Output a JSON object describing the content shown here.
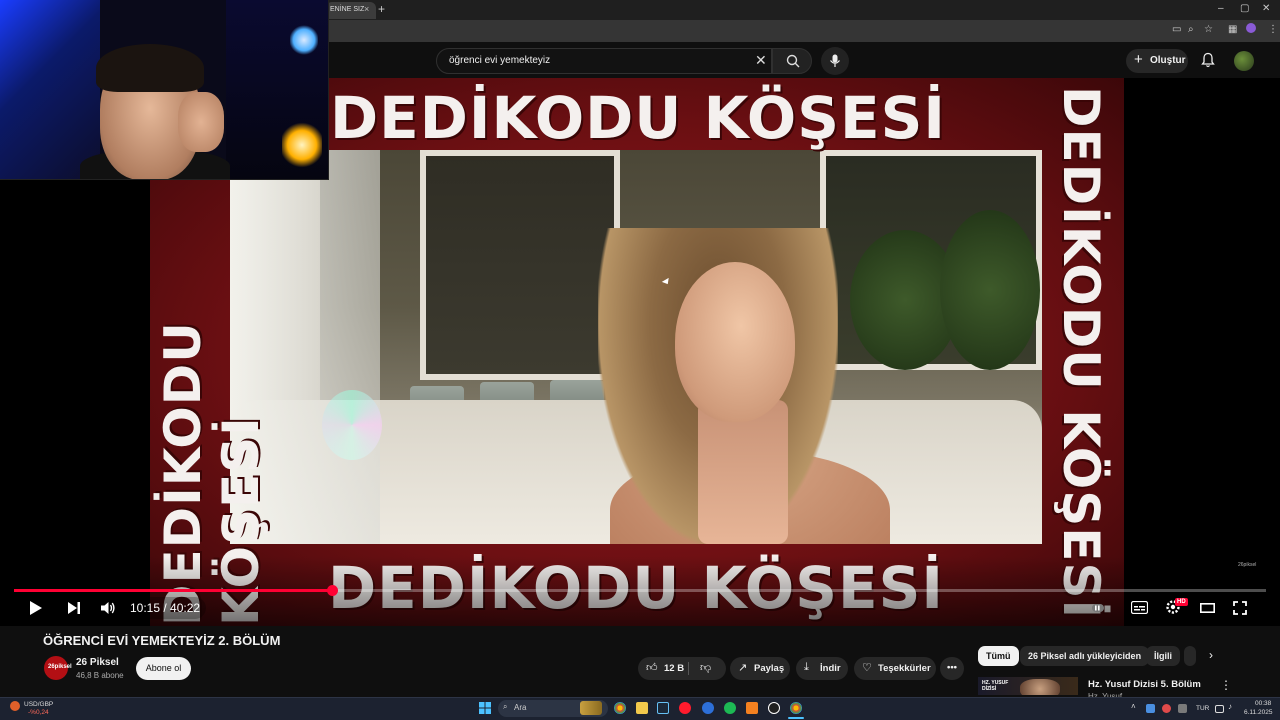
{
  "browser": {
    "tab_title": "ENİNE SIZ",
    "tab_close": "×",
    "new_tab": "+",
    "window_controls": [
      "–",
      "▢",
      "✕"
    ]
  },
  "search": {
    "query": "öğrenci evi yemekteyiz",
    "clear_label": "✕"
  },
  "header": {
    "create_label": "Oluştur",
    "create_plus": "+"
  },
  "video": {
    "banner_text": "DEDİKODU KÖŞESİ",
    "watermark": "26piksel",
    "current_time": "10:15",
    "separator": " / ",
    "duration": "40:22",
    "progress": 0.254,
    "hd_badge": "HD"
  },
  "meta": {
    "title": "ÖĞRENCİ EVİ YEMEKTEYİZ 2. BÖLÜM",
    "channel_name": "26 Piksel",
    "channel_avatar_text": "26piksel",
    "subscribers": "46,8 B abone",
    "subscribe_label": "Abone ol",
    "like_count": "12 B",
    "share_label": "Paylaş",
    "download_label": "İndir",
    "thanks_label": "Teşekkürler",
    "more_label": "•••"
  },
  "chips": [
    "Tümü",
    "26 Piksel adlı yükleyiciden",
    "İlgili"
  ],
  "recommendation": {
    "title": "Hz. Yusuf Dizisi 5. Bölüm",
    "channel": "Hz. Yusuf",
    "thumb_text": "HZ. YUSUF DİZİSİ"
  },
  "taskbar": {
    "ticker_name": "USD/GBP",
    "ticker_change": "-%0,24",
    "search_placeholder": "Ara",
    "lang": "TUR",
    "time": "00:38",
    "date": "6.11.2025"
  },
  "colors": {
    "accent": "#ff0033",
    "banner_red": "#8a1418",
    "bg": "#0f0f0f"
  }
}
